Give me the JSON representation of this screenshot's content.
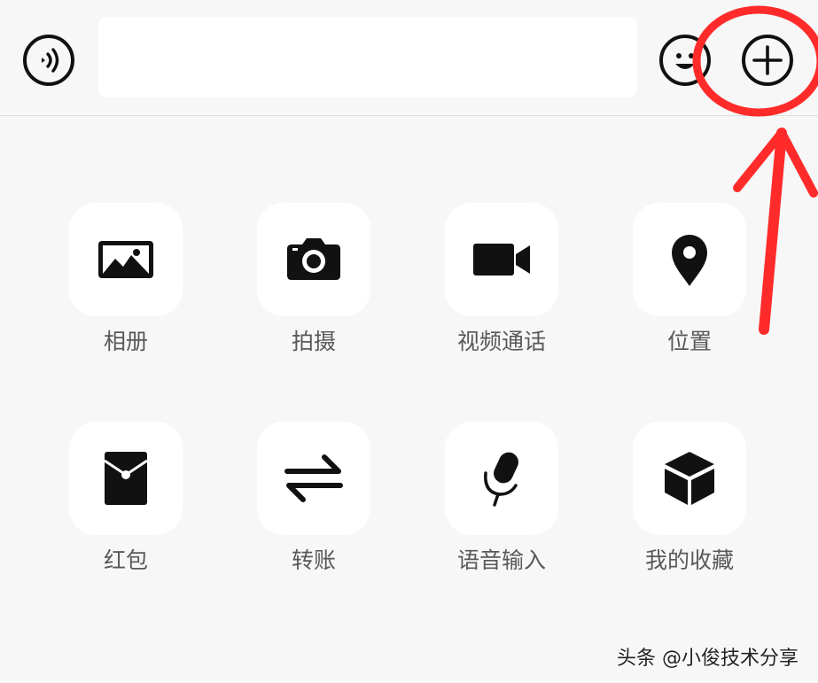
{
  "input_bar": {
    "voice_icon": "voice-icon",
    "text_value": "",
    "emoji_icon": "emoji-icon",
    "plus_icon": "plus-icon"
  },
  "panel": {
    "items": [
      {
        "label": "相册",
        "icon": "photo-icon"
      },
      {
        "label": "拍摄",
        "icon": "camera-icon"
      },
      {
        "label": "视频通话",
        "icon": "video-call-icon"
      },
      {
        "label": "位置",
        "icon": "location-icon"
      },
      {
        "label": "红包",
        "icon": "red-packet-icon"
      },
      {
        "label": "转账",
        "icon": "transfer-icon"
      },
      {
        "label": "语音输入",
        "icon": "microphone-icon"
      },
      {
        "label": "我的收藏",
        "icon": "favorites-icon"
      }
    ]
  },
  "annotation": {
    "color": "#ff2b2b"
  },
  "watermark": {
    "text": "头条 @小俊技术分享"
  }
}
